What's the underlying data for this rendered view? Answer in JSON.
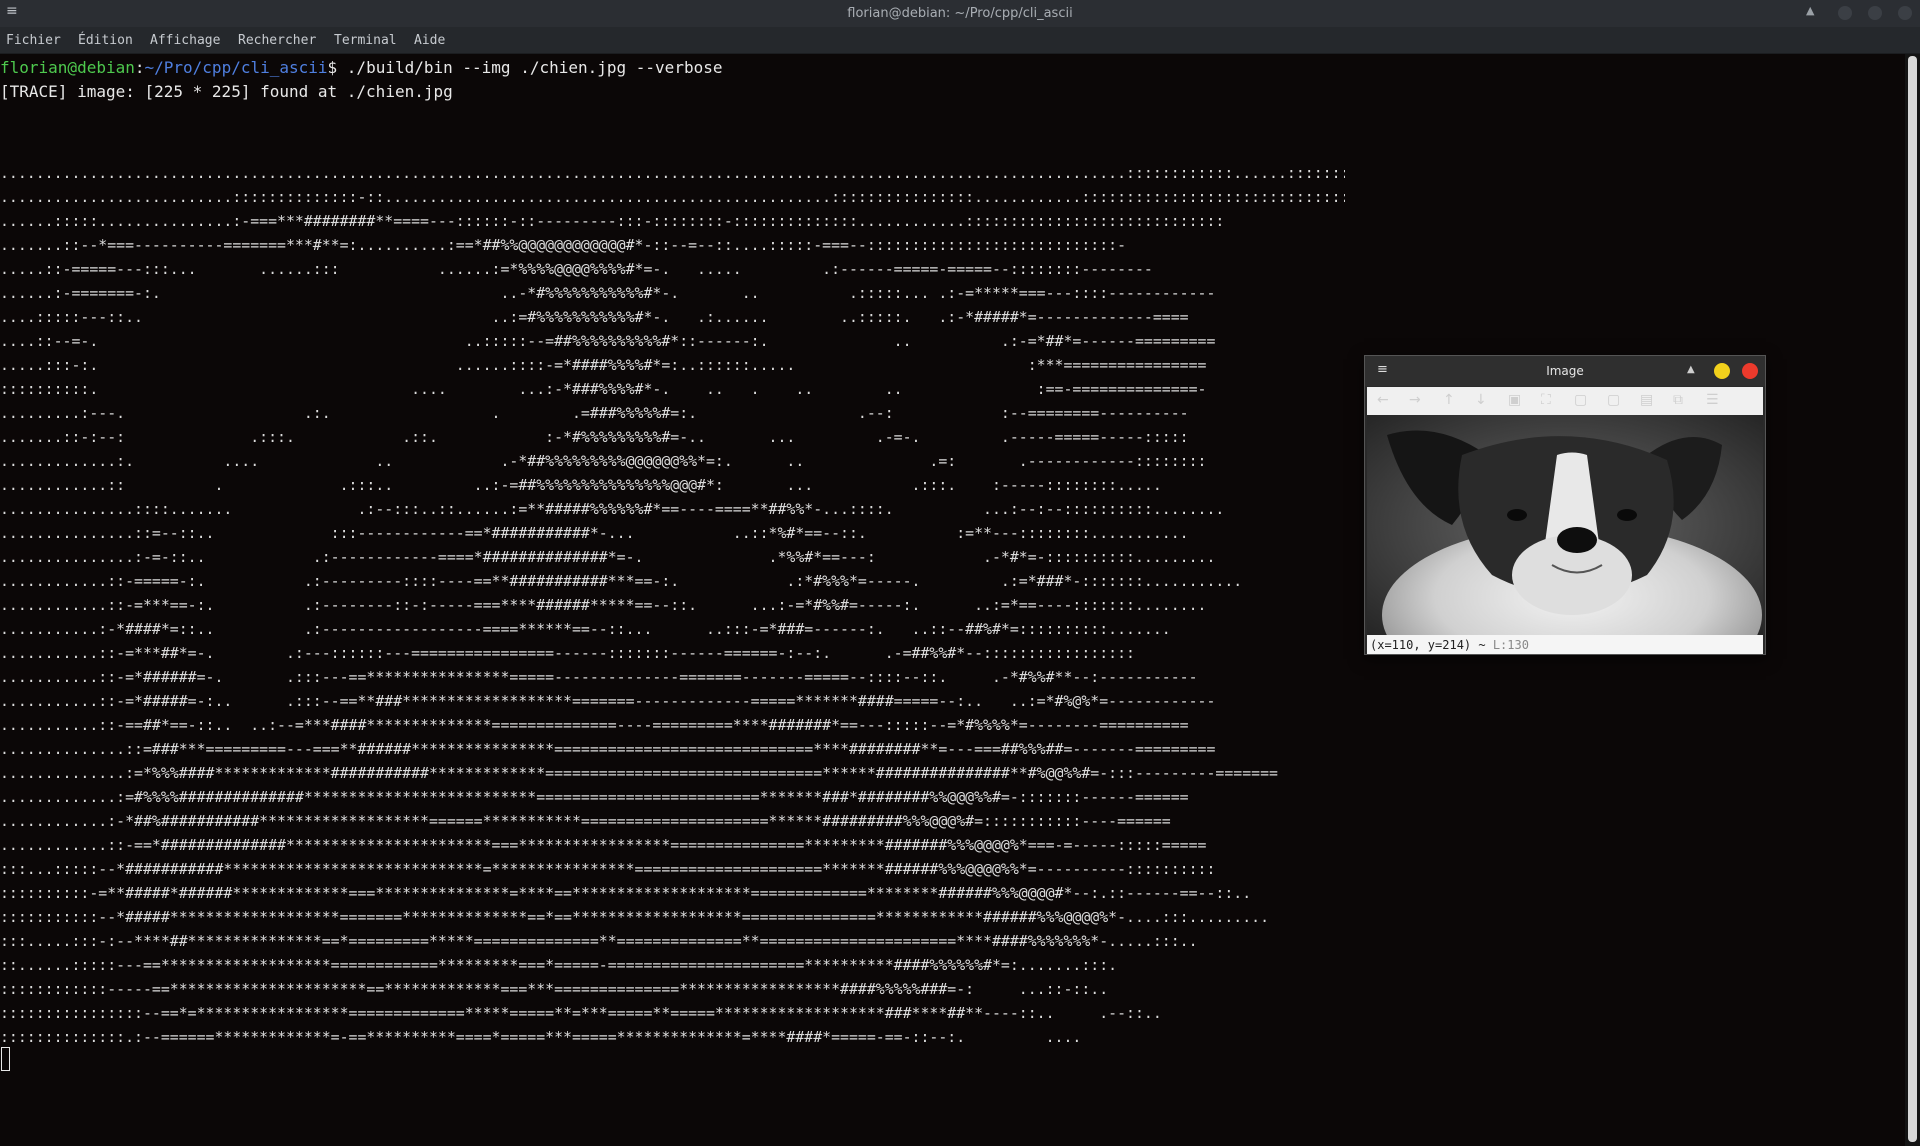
{
  "window": {
    "title": "florian@debian: ~/Pro/cpp/cli_ascii",
    "menu_icon": "≡",
    "up_icon": "▲"
  },
  "menubar": {
    "items": [
      "Fichier",
      "Édition",
      "Affichage",
      "Rechercher",
      "Terminal",
      "Aide"
    ]
  },
  "terminal": {
    "prompt_user": "florian@debian",
    "prompt_sep": ":",
    "prompt_path": "~/Pro/cpp/cli_ascii",
    "prompt_symbol": "$ ",
    "command": "./build/bin --img ./chien.jpg --verbose",
    "trace": "[TRACE] image: [225 * 225] found at ./chien.jpg",
    "ascii_rows": [
      "..............................................................................................................................::::::::::::......::::::::::::::::::::::-:::::::::::::",
      "..........................::::::::::::::-::..................................................::::::::::::::::............::::::::::::::::::::::::::::::::",
      "......:::::...............:-===***########**====---::::::-::---------:::-::::::::-::::::::::::::............:::::::::::::::::::::::::::::",
      ".......::--*===----------=======***#**=:..........:==*##%%@@@@@@@@@@@@#*-::--=--::....:::::-===--::::::::::::::::::::::::::::-",
      ".....::-=====---:::...       ......:::           ......:=*%%%%@@@@%%%%#*=-.   .....         .:------=====-=====--::::::::--------",
      "......:-=======-:.                                      ..-*#%%%%%%%%%%%#*-.       ..          .:::::... .:-=*****===---::::------------",
      "....:::::---::..                                       ..:=#%%%%%%%%%%%#*-.   .:......        ..:::::.   .:-*#####*=-------------====",
      "....::--=-.                                         ..:::::--=##%%%%%%%%%%#*::------:.              ..          .:-=*##*=------=========",
      ".....:::-:.                                        ......::::-=*####%%%%#*=:..::::::.....                          :***================",
      "::::::::::.                                   ....        ...:-*###%%%%#*-.    ..   .    ..        ..               :==-==============-",
      ".........:---.                    .:.                  .        .=###%%%%%#=:.                  .--:            :--========----------",
      ".......::-:--:              .:::.            .::.            :-*#%%%%%%%%%#=-..       ...         .-=-.         .-----=====-----:::::",
      ".............:.          ....             ..            .-*##%%%%%%%%%@@@@@@%%*=:.      ..              .=:       .------------::::::::",
      "............::          .             .:::..         ..:-=##%%%%%%%%%%%%%%%@@@#*:       ...           .:::.    :-----::::::::.....",
      "...............::::.......              .:--:::..::......:=**#####%%%%%%#*==----====**##%%*-...::::.          ...:--:--::::::::::........",
      "...............::=--::..             :::------------==*###########*-...           ..::*%#*==--::.          :=**---::::::::...........",
      "...............:-=-::..            .:------------====*##############*=-.              .*%%#*==---:            .-*#*=-::::::::::.........",
      "............::-=====-:.           .:---------::::----==**###########***==-:.            .:*#%%%*=-----.         .:=*###*-:::::::...........",
      "............::-=***==-:.          .:--------::-:-----===****######*****==--::.      ...:-=*#%%#=-----:.      ..:=*==----:::::::........",
      "...........:-*####*=::..          .:------------------====******==--::...      ..:::-=*###=------:.   ..::--##%#*=::::::::::.......",
      "...........::-=***##*=-.        .:---::::::---================------:::::::------======-:--:.      .-=##%%#*--:::::::::::::::::",
      "...........::-=*######=-.       .:::---==****************=====--------------=======-------=====--::::--::.     .-*#%%#**--:-----------",
      "...........::-=*#####=-:..      .:::--==**###*******************=======-------------=====*******####=====--:..   ..:=*#%@%*=------------",
      "...........::-==##*==-::..  ..:--=***####**************==============----=========****#######*==---:::::--=*#%%%%*=--------==========",
      "..............::=###***=========---===**######****************=============================****########**=---===##%%%##=-------=========",
      "..............:=*%%%####*************###########*************===============================******###############**#%@@%%#=-:::---------=======",
      ".............:=#%%%%##############**************************=========================*******###*########%%@@@%%#=-:::::::------======",
      "............:-*##%###########*******************======***********=====================******#########%%%@@@%#=:::::::::::----======",
      "............::-==*##############***********************===*****************===============*********#######%%%@@@@%*===-=-----:::::=====",
      ":::...:::::--*###########*****************************=****************=====================*******######%%%@@@@%%*=----------::::::::::",
      "::::::::::-=**#####*######*************===***************=****==********************=============********######%%%@@@@#*--:.::------==--::..",
      ":::::::::::--*#####*******************=======**************==*==*******************===============************######%%%@@@@%*-....:::.........",
      ":::.....:::-:--****##***************==*=========*****==============**==============**======================****####%%%%%%%*-.....:::..",
      "::......:::::---==*******************============*********===*=====-======================**********####%%%%%%#*=:.......:::.",
      "::::::::::::-----==**********************==*************===***==============******************####%%%%%###=-:     ...::-::..",
      "::::::::::::::::--==*=*****************=============*****=====**=***=====**=====*******************###****##**----::..     .--::..",
      "::::::::::::::.:--======*************=-==**********====*=====***=====**************=****####*=====-==-::--:.         ...."
    ]
  },
  "viewer": {
    "title": "Image",
    "menu_icon": "≡",
    "up_icon": "▲",
    "toolbar": [
      "←",
      "→",
      "↑",
      "↓",
      "▣",
      "⛶",
      "▢",
      "▢",
      "▤",
      "⧉",
      "☰"
    ],
    "status_coords": "(x=110, y=214) ~ ",
    "status_lum": "L:130"
  }
}
